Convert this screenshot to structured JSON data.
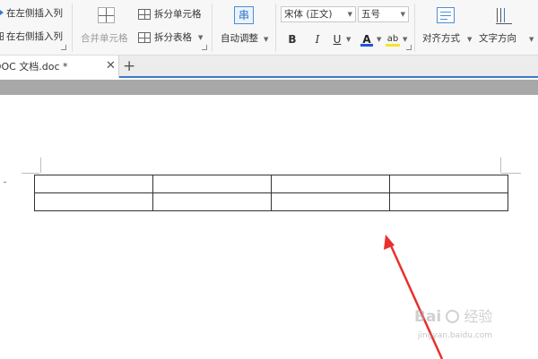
{
  "ribbon": {
    "insert_col_left": "在左侧插入列",
    "insert_col_right": "在右侧插入列",
    "merge_cells": "合并单元格",
    "split_cells": "拆分单元格",
    "split_table": "拆分表格",
    "auto_adjust": "自动调整",
    "font_name": "宋体 (正文)",
    "font_size": "五号",
    "bold": "B",
    "italic": "I",
    "underline": "U",
    "font_color": "A",
    "highlight": "ab",
    "align": "对齐方式",
    "text_direction": "文字方向",
    "auto_adjust_icon_char": "串"
  },
  "tabs": {
    "doc_title": "DOC 文档.doc *",
    "close": "✕",
    "add": "+"
  },
  "document": {
    "table_rows": 2,
    "table_cols": 4
  },
  "watermark": {
    "logo_text": "Bai",
    "logo_suffix": "经验",
    "url": "jingyan.baidu.com"
  },
  "colors": {
    "accent": "#3b7bc7",
    "arrow": "#e8302c",
    "font_color_bar": "#1f55d8",
    "highlight_bar": "#f5e32a"
  }
}
